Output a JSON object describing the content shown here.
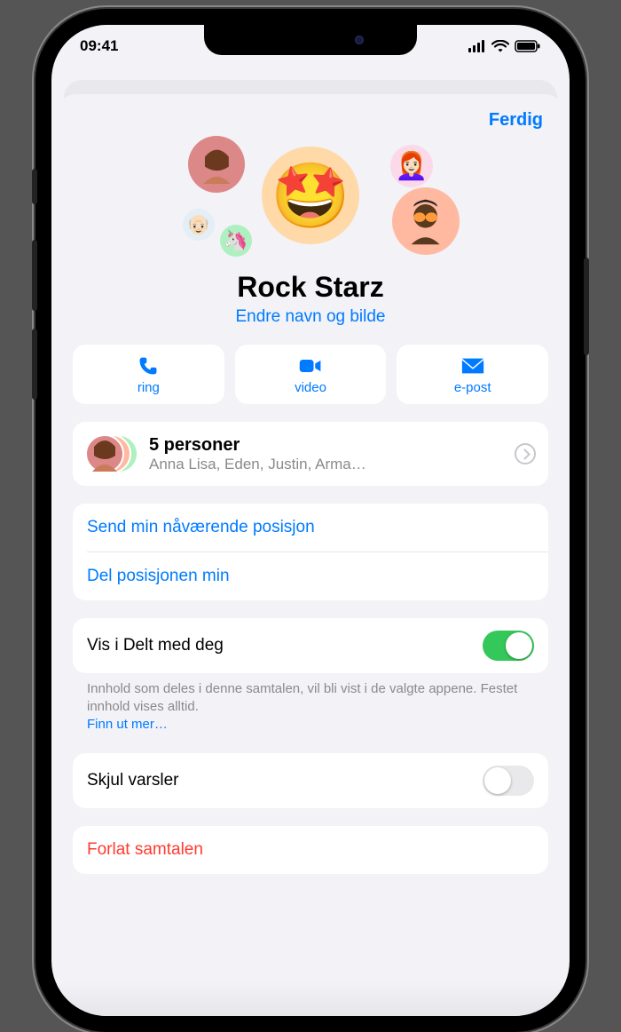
{
  "status": {
    "time": "09:41"
  },
  "header": {
    "done": "Ferdig"
  },
  "group": {
    "name": "Rock Starz",
    "edit_label": "Endre navn og bilde"
  },
  "actions": {
    "call": "ring",
    "video": "video",
    "mail": "e-post"
  },
  "people": {
    "count_label": "5 personer",
    "names": "Anna Lisa, Eden, Justin, Arma…"
  },
  "location": {
    "send_current": "Send min nåværende posisjon",
    "share": "Del posisjonen min"
  },
  "shared": {
    "label": "Vis i Delt med deg",
    "on": true,
    "note": "Innhold som deles i denne samtalen, vil bli vist i de valgte appene. Festet innhold vises alltid.",
    "learn_more": "Finn ut mer…"
  },
  "hide_alerts": {
    "label": "Skjul varsler",
    "on": false
  },
  "leave": {
    "label": "Forlat samtalen"
  }
}
